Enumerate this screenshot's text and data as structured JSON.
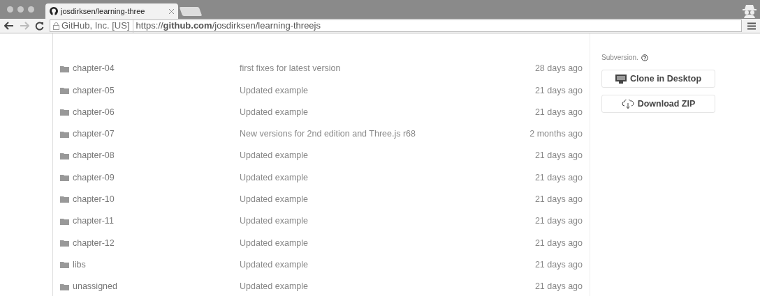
{
  "browser": {
    "tab": {
      "title": "josdirksen/learning-three",
      "selected": true
    },
    "identity": "GitHub, Inc. [US]",
    "url": "https://**github.com**/josdirksen/learning-threejs"
  },
  "files": [
    {
      "name": "chapter-04",
      "message": "first fixes for latest version",
      "age": "28 days ago"
    },
    {
      "name": "chapter-05",
      "message": "Updated example",
      "age": "21 days ago"
    },
    {
      "name": "chapter-06",
      "message": "Updated example",
      "age": "21 days ago"
    },
    {
      "name": "chapter-07",
      "message": "New versions for 2nd edition and Three.js r68",
      "age": "2 months ago"
    },
    {
      "name": "chapter-08",
      "message": "Updated example",
      "age": "21 days ago"
    },
    {
      "name": "chapter-09",
      "message": "Updated example",
      "age": "21 days ago"
    },
    {
      "name": "chapter-10",
      "message": "Updated example",
      "age": "21 days ago"
    },
    {
      "name": "chapter-11",
      "message": "Updated example",
      "age": "21 days ago"
    },
    {
      "name": "chapter-12",
      "message": "Updated example",
      "age": "21 days ago"
    },
    {
      "name": "libs",
      "message": "Updated example",
      "age": "21 days ago"
    },
    {
      "name": "unassigned",
      "message": "Updated example",
      "age": "21 days ago"
    }
  ],
  "sidebar": {
    "note": "Subversion.",
    "buttons": [
      {
        "kind": "desktop",
        "label": "Clone in Desktop"
      },
      {
        "kind": "download",
        "label": "Download ZIP"
      }
    ]
  }
}
